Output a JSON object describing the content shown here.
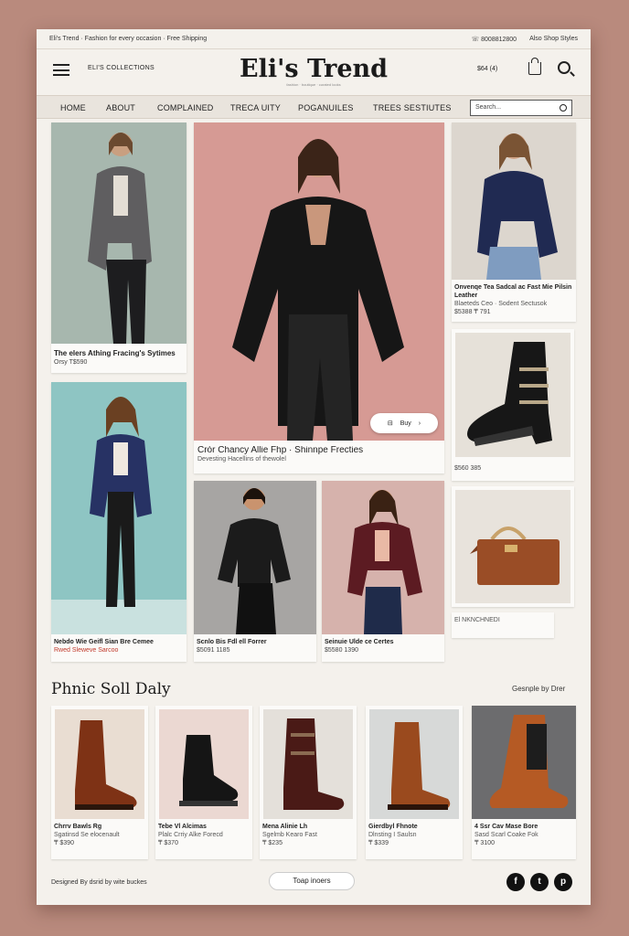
{
  "topbar": {
    "left": "Eli's Trend · Fashion for every occasion · Free Shipping",
    "phone": "☏ 8008812800",
    "right": "Also Shop Styles"
  },
  "header": {
    "store_label": "ELI'S COLLECTIONS",
    "logo": "Eli's Trend",
    "logo_sub": "fashion · boutique · curated looks",
    "count": "$64 (4)"
  },
  "nav": {
    "items": [
      "HOME",
      "ABOUT",
      "COMPLAINED",
      "TRECA UITY",
      "POGANUILES",
      "TREES SESTIUTES"
    ],
    "search_placeholder": "Search..."
  },
  "products": {
    "gray_blazer": {
      "title": "The elers Athing Fracing's Sytimes",
      "price": "Orsy T$590"
    },
    "hero": {
      "title": "Crór Chancy Allie Fhp · Shinnpe Frecties",
      "subtitle": "Devesting Hacellins of thewolel",
      "badge": "Buy"
    },
    "navy_blazer": {
      "title": "Onvenqe Tea Sadcal ac Fast Mie Pilsin Leather",
      "subtitle": "Blaeteds Ceo · Sodent Sectusok",
      "price": "$5388  ₸ 791"
    },
    "combat_boot": {
      "price": "$560 385"
    },
    "teal_look": {
      "title": "Nebdo Wie Geifl Sian Bre Cemee",
      "subtitle": "Rwed Sleweve Sarcoo"
    },
    "black_look": {
      "title": "Scnlo Bis Fdl ell Forrer",
      "price": "$5091 1185"
    },
    "burgundy_look": {
      "title": "Seinuie Ulde ce Certes",
      "price": "$5580 1390"
    },
    "handbag": {
      "title": "El NKNCHNEDI"
    }
  },
  "section": {
    "title": "Phnic Soll Daly",
    "link": "Gesnple by Drer"
  },
  "boots": [
    {
      "title": "Chrrv Bawls Rg",
      "subtitle": "Sgatinsd Se elocenault",
      "price": "₸ $390"
    },
    {
      "title": "Tebe Vl Alcimas",
      "subtitle": "Plalc Crriy Alke Forecd",
      "price": "₸ $370"
    },
    {
      "title": "Mena Alinie Lh",
      "subtitle": "Sgelmb Kearo Fast",
      "price": "₸ $235"
    },
    {
      "title": "Gierdbyl Fhnote",
      "subtitle": "Dlnsting I Saulsn",
      "price": "₸ $339"
    },
    {
      "title": "4 Ssr Cav Mase Bore",
      "subtitle": "Sasd Scarl Coake Fok",
      "price": "₸ 3100"
    }
  ],
  "footer": {
    "credit": "Designed By dsrid by wite buckes",
    "top_button": "Toap inoers",
    "social": [
      "f",
      "t",
      "p"
    ]
  },
  "colors": {
    "background": "#b98a7d",
    "page": "#f4f1ec",
    "accent_badge": "#c0392b"
  }
}
